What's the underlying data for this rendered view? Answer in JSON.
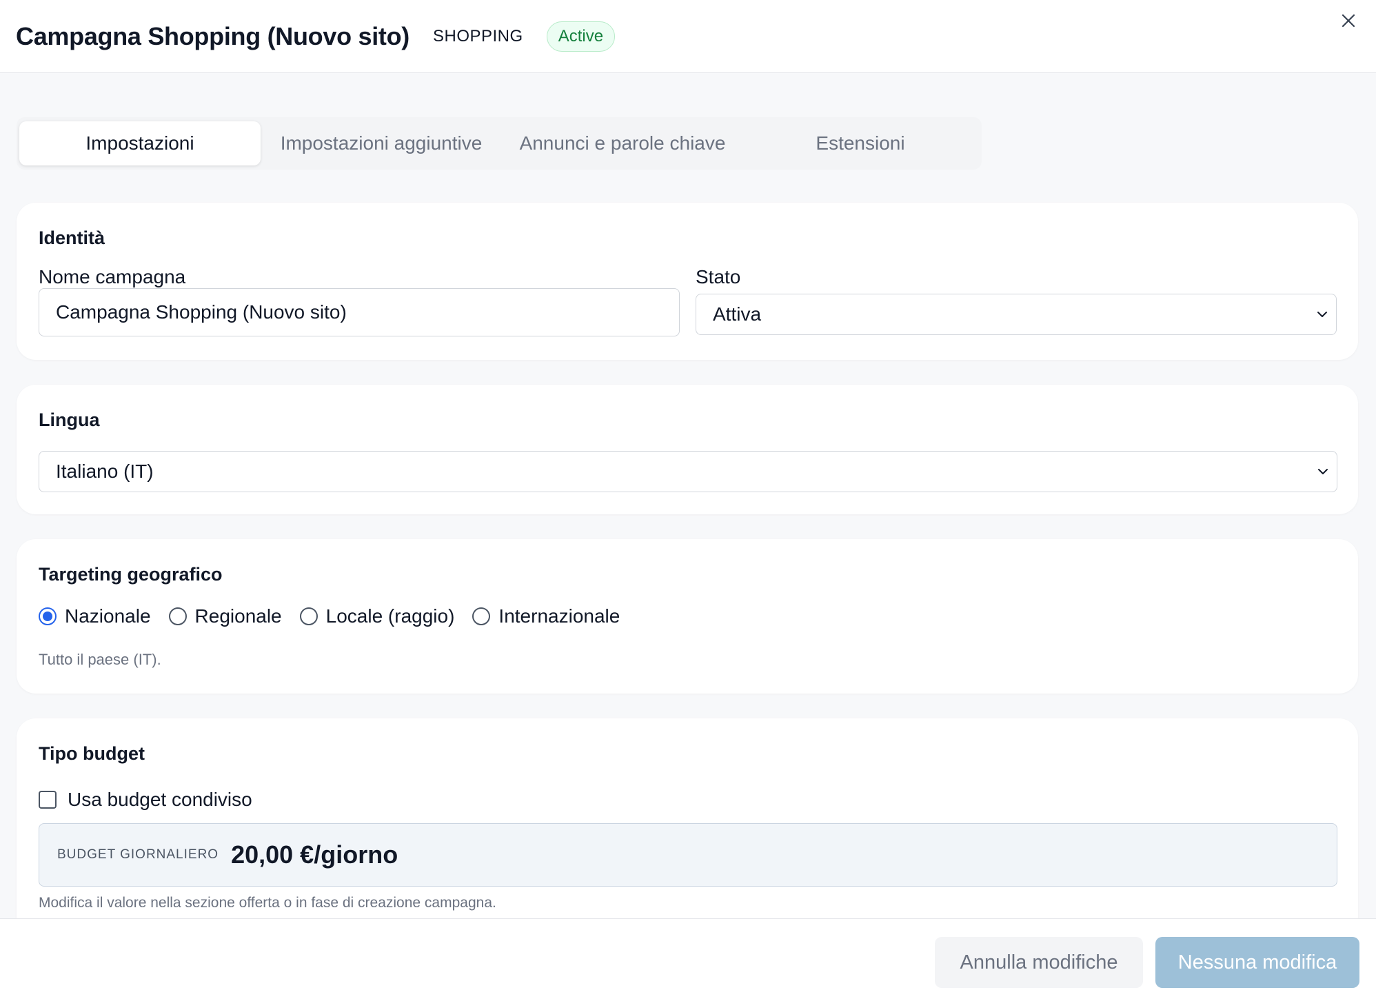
{
  "header": {
    "title": "Campagna Shopping (Nuovo sito)",
    "type_badge": "SHOPPING",
    "status_badge": "Active",
    "close_icon": "close-icon"
  },
  "tabs": [
    {
      "label": "Impostazioni",
      "active": true
    },
    {
      "label": "Impostazioni aggiuntive",
      "active": false
    },
    {
      "label": "Annunci e parole chiave",
      "active": false
    },
    {
      "label": "Estensioni",
      "active": false
    }
  ],
  "identity": {
    "title": "Identità",
    "name_label": "Nome campagna",
    "name_value": "Campagna Shopping (Nuovo sito)",
    "status_label": "Stato",
    "status_value": "Attiva"
  },
  "language": {
    "title": "Lingua",
    "value": "Italiano (IT)"
  },
  "geo": {
    "title": "Targeting geografico",
    "options": [
      {
        "label": "Nazionale",
        "checked": true
      },
      {
        "label": "Regionale",
        "checked": false
      },
      {
        "label": "Locale (raggio)",
        "checked": false
      },
      {
        "label": "Internazionale",
        "checked": false
      }
    ],
    "hint": "Tutto il paese (IT)."
  },
  "budget": {
    "title": "Tipo budget",
    "shared_label": "Usa budget condiviso",
    "daily_label": "BUDGET GIORNALIERO",
    "daily_value": "20,00 €/giorno",
    "hint": "Modifica il valore nella sezione offerta o in fase di creazione campagna."
  },
  "footer": {
    "cancel_label": "Annulla modifiche",
    "save_label": "Nessuna modifica"
  },
  "colors": {
    "accent": "#2563eb",
    "status_green": "#15803d",
    "save_disabled": "#9dc0d8"
  }
}
